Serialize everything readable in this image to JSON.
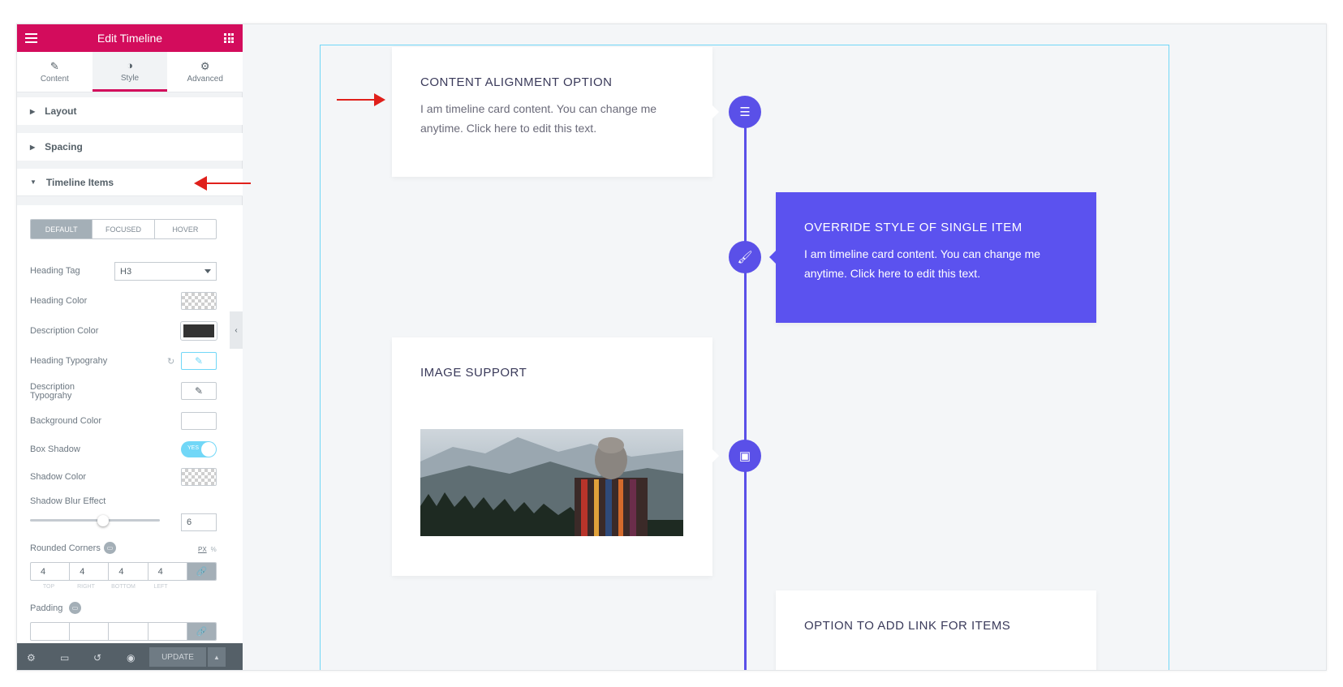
{
  "panel": {
    "title": "Edit Timeline",
    "tabs": [
      {
        "label": "Content",
        "icon": "pencil-icon"
      },
      {
        "label": "Style",
        "icon": "contrast-icon"
      },
      {
        "label": "Advanced",
        "icon": "gear-icon"
      }
    ],
    "sections": {
      "layout": "Layout",
      "spacing": "Spacing",
      "timeline_items": "Timeline Items"
    },
    "states": [
      "DEFAULT",
      "FOCUSED",
      "HOVER"
    ],
    "controls": {
      "heading_tag_label": "Heading Tag",
      "heading_tag_value": "H3",
      "heading_color_label": "Heading Color",
      "description_color_label": "Description Color",
      "description_color_value": "#333333",
      "heading_typography_label": "Heading Typograhy",
      "description_typography_label": "Description Typograhy",
      "background_color_label": "Background Color",
      "box_shadow_label": "Box Shadow",
      "box_shadow_toggle": "YES",
      "shadow_color_label": "Shadow Color",
      "shadow_blur_label": "Shadow Blur Effect",
      "shadow_blur_value": "6",
      "rounded_corners_label": "Rounded Corners",
      "units_px": "PX",
      "units_percent": "%",
      "corners": [
        "4",
        "4",
        "4",
        "4"
      ],
      "corner_labels": [
        "TOP",
        "RIGHT",
        "BOTTOM",
        "LEFT"
      ],
      "padding_label": "Padding"
    },
    "footer": {
      "update_label": "UPDATE"
    }
  },
  "timeline": {
    "accent_color": "#5a50e8",
    "items": [
      {
        "title": "CONTENT ALIGNMENT OPTION",
        "text": "I am timeline card content. You can change me anytime. Click here to edit this text.",
        "icon": "align-left-icon"
      },
      {
        "title": "OVERRIDE STYLE OF SINGLE ITEM",
        "text": "I am timeline card content. You can change me anytime. Click here to edit this text.",
        "icon": "brush-icon"
      },
      {
        "title": "IMAGE SUPPORT",
        "icon": "image-icon"
      },
      {
        "title": "OPTION TO ADD LINK FOR ITEMS"
      }
    ]
  }
}
